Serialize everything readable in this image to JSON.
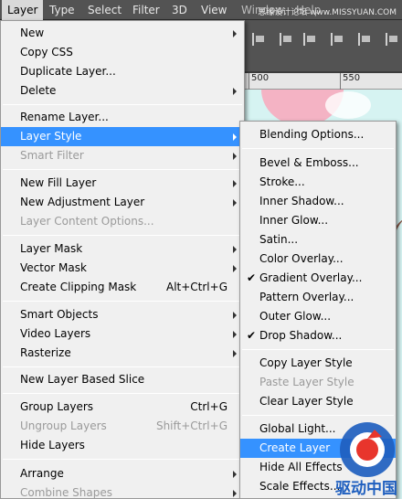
{
  "menubar": {
    "items": [
      {
        "label": "Layer"
      },
      {
        "label": "Type"
      },
      {
        "label": "Select"
      },
      {
        "label": "Filter"
      },
      {
        "label": "3D"
      },
      {
        "label": "View"
      },
      {
        "label": "Window"
      },
      {
        "label": "Help"
      }
    ],
    "watermark": "思缘设计论坛 www.MISSYUAN.COM"
  },
  "ruler": {
    "mark": "500",
    "mark2": "550"
  },
  "layer_menu": {
    "items": [
      {
        "label": "New",
        "shortcut": "",
        "submenu": true
      },
      {
        "label": "Copy CSS",
        "shortcut": ""
      },
      {
        "label": "Duplicate Layer...",
        "shortcut": ""
      },
      {
        "label": "Delete",
        "shortcut": "",
        "submenu": true
      },
      {
        "label": "Rename Layer...",
        "shortcut": ""
      },
      {
        "label": "Layer Style",
        "shortcut": "",
        "submenu": true,
        "highlighted": true
      },
      {
        "label": "Smart Filter",
        "shortcut": "",
        "submenu": true,
        "disabled": true
      },
      {
        "label": "New Fill Layer",
        "shortcut": "",
        "submenu": true
      },
      {
        "label": "New Adjustment Layer",
        "shortcut": "",
        "submenu": true
      },
      {
        "label": "Layer Content Options...",
        "shortcut": "",
        "disabled": true
      },
      {
        "label": "Layer Mask",
        "shortcut": "",
        "submenu": true
      },
      {
        "label": "Vector Mask",
        "shortcut": "",
        "submenu": true
      },
      {
        "label": "Create Clipping Mask",
        "shortcut": "Alt+Ctrl+G"
      },
      {
        "label": "Smart Objects",
        "shortcut": "",
        "submenu": true
      },
      {
        "label": "Video Layers",
        "shortcut": "",
        "submenu": true
      },
      {
        "label": "Rasterize",
        "shortcut": "",
        "submenu": true
      },
      {
        "label": "New Layer Based Slice",
        "shortcut": ""
      },
      {
        "label": "Group Layers",
        "shortcut": "Ctrl+G"
      },
      {
        "label": "Ungroup Layers",
        "shortcut": "Shift+Ctrl+G",
        "disabled": true
      },
      {
        "label": "Hide Layers",
        "shortcut": ""
      },
      {
        "label": "Arrange",
        "shortcut": "",
        "submenu": true
      },
      {
        "label": "Combine Shapes",
        "shortcut": "",
        "submenu": true,
        "disabled": true
      }
    ]
  },
  "style_menu": {
    "items": [
      {
        "label": "Blending Options..."
      },
      {
        "label": "Bevel & Emboss..."
      },
      {
        "label": "Stroke..."
      },
      {
        "label": "Inner Shadow..."
      },
      {
        "label": "Inner Glow..."
      },
      {
        "label": "Satin..."
      },
      {
        "label": "Color Overlay..."
      },
      {
        "label": "Gradient Overlay...",
        "checked": true
      },
      {
        "label": "Pattern Overlay..."
      },
      {
        "label": "Outer Glow..."
      },
      {
        "label": "Drop Shadow...",
        "checked": true
      },
      {
        "label": "Copy Layer Style"
      },
      {
        "label": "Paste Layer Style",
        "disabled": true
      },
      {
        "label": "Clear Layer Style"
      },
      {
        "label": "Global Light..."
      },
      {
        "label": "Create Layer",
        "highlighted": true
      },
      {
        "label": "Hide All Effects"
      },
      {
        "label": "Scale Effects..."
      }
    ]
  },
  "logo": {
    "text": "驱动中国"
  },
  "colors": {
    "highlight": "#3592ff",
    "menu_bg": "#f0f0f0",
    "menubar_bg": "#535353"
  }
}
